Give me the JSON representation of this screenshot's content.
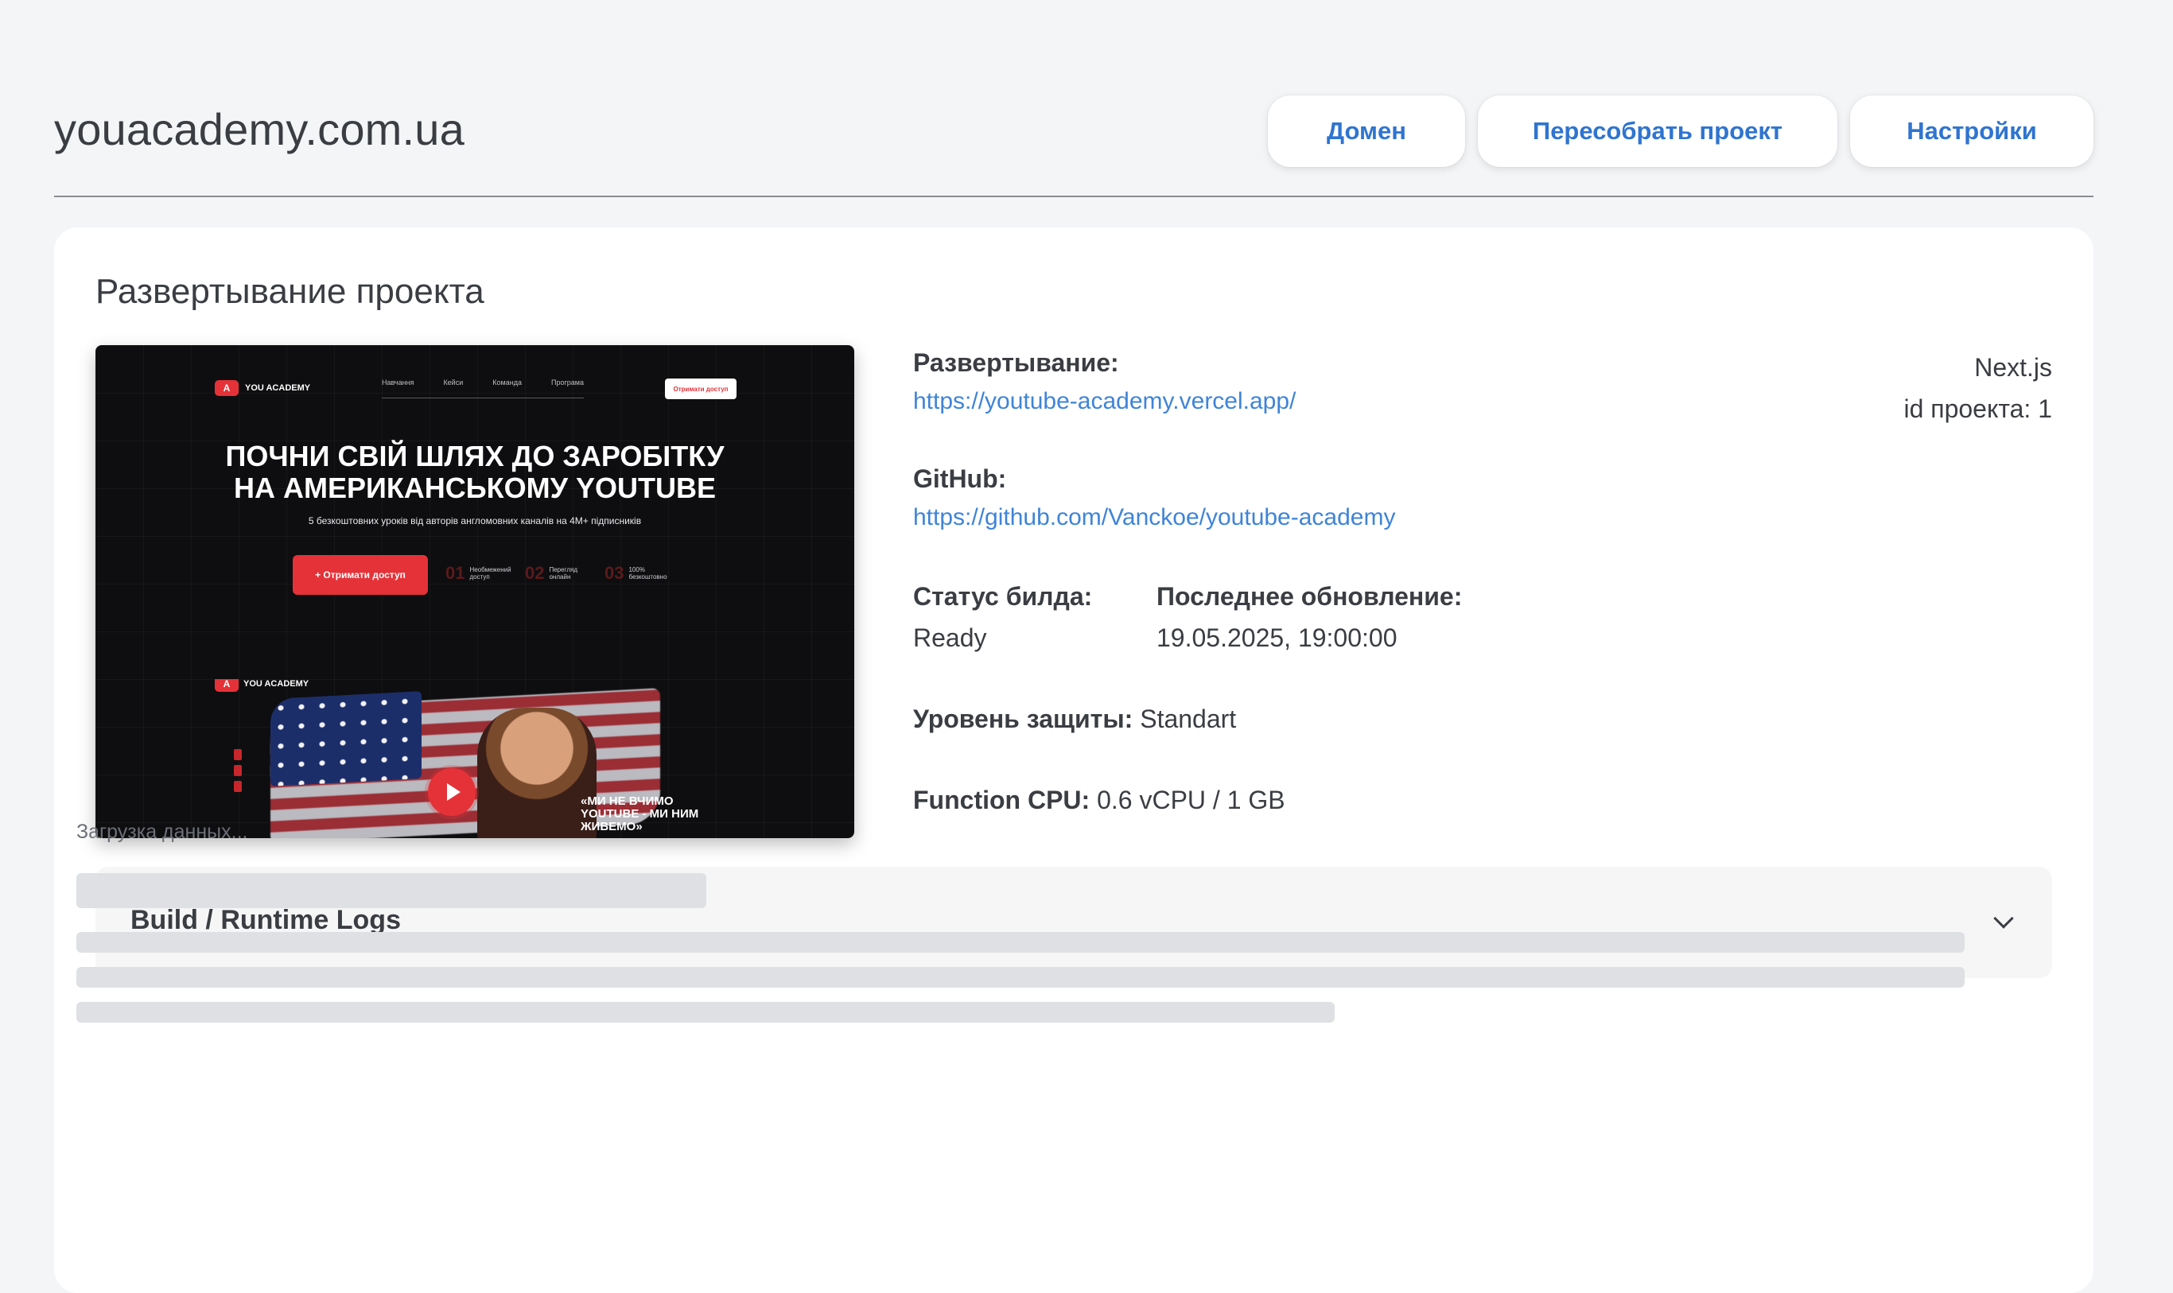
{
  "header": {
    "title": "youacademy.com.ua",
    "buttons": {
      "domain": "Домен",
      "rebuild": "Пересобрать проект",
      "settings": "Настройки"
    }
  },
  "card": {
    "title": "Развертывание проекта",
    "preview": {
      "logo_text": "YOU ACADEMY",
      "nav": [
        "Навчання",
        "Кейси",
        "Команда",
        "Програма"
      ],
      "nav_button": "Отримати доступ",
      "headline_line1": "ПОЧНИ СВІЙ ШЛЯХ ДО ЗАРОБІТКУ",
      "headline_line2": "НА АМЕРИКАНСЬКОМУ YOUTUBE",
      "subtitle": "5 безкоштовних уроків від авторів англомовних каналів на 4М+ підписників",
      "cta": "+ Отримати доступ",
      "stats": [
        {
          "num": "01",
          "label": "Необмежений доступ"
        },
        {
          "num": "02",
          "label": "Перегляд онлайн"
        },
        {
          "num": "03",
          "label": "100% безкоштовно"
        }
      ],
      "quote": "«МИ НЕ ВЧИМО YOUTUBE - МИ НИМ ЖИВЕМО»"
    },
    "deployment_label": "Развертывание:",
    "deployment_url": "https://youtube-academy.vercel.app/",
    "github_label": "GitHub:",
    "github_url": "https://github.com/Vanckoe/youtube-academy",
    "build_status_label": "Статус билда:",
    "build_status_value": "Ready",
    "last_update_label": "Последнее обновление:",
    "last_update_value": "19.05.2025, 19:00:00",
    "protection_label": "Уровень защиты:",
    "protection_value": "Standart",
    "cpu_label": "Function CPU:",
    "cpu_value": "0.6 vCPU / 1 GB",
    "framework": "Next.js",
    "project_id": "id проекта: 1",
    "logs_title": "Build / Runtime Logs",
    "loading_text": "Загрузка данных..."
  },
  "colors": {
    "accent": "#3f84d8",
    "brand_red": "#e53238",
    "background": "#f4f5f7"
  },
  "icons": {
    "logs_toggle": "chevron-down-icon",
    "video_play": "play-icon"
  }
}
